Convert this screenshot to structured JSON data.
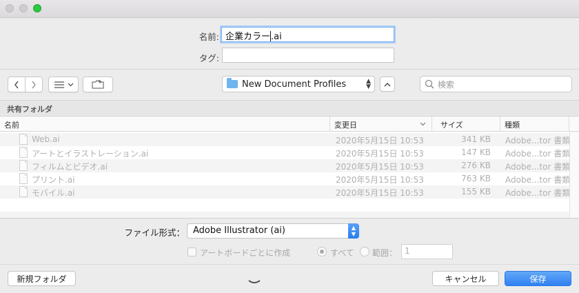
{
  "save": {
    "name_label": "名前:",
    "name_value": "企業カラー",
    "name_suffix": ".ai",
    "tags_label": "タグ:",
    "tags_value": ""
  },
  "toolbar": {
    "location": "New Document Profiles",
    "search_placeholder": "検索"
  },
  "sidebar": {
    "section": "共有フォルダ"
  },
  "table": {
    "columns": {
      "name": "名前",
      "modified": "変更日",
      "size": "サイズ",
      "kind": "種類"
    },
    "rows": [
      {
        "name": "Web.ai",
        "modified": "2020年5月15日 10:53",
        "size": "341 KB",
        "kind": "Adobe...tor 書類"
      },
      {
        "name": "アートとイラストレーション.ai",
        "modified": "2020年5月15日 10:53",
        "size": "147 KB",
        "kind": "Adobe...tor 書類"
      },
      {
        "name": "フィルムとビデオ.ai",
        "modified": "2020年5月15日 10:53",
        "size": "276 KB",
        "kind": "Adobe...tor 書類"
      },
      {
        "name": "プリント.ai",
        "modified": "2020年5月15日 10:53",
        "size": "763 KB",
        "kind": "Adobe...tor 書類"
      },
      {
        "name": "モバイル.ai",
        "modified": "2020年5月15日 10:53",
        "size": "155 KB",
        "kind": "Adobe...tor 書類"
      }
    ]
  },
  "options": {
    "format_label": "ファイル形式：",
    "format_value": "Adobe Illustrator (ai)",
    "artboards_label": "アートボードごとに作成",
    "all_label": "すべて",
    "range_label": "範囲：",
    "range_value": "1"
  },
  "footer": {
    "new_folder": "新規フォルダ",
    "cancel": "キャンセル",
    "save": "保存"
  },
  "colors": {
    "accent": "#2f80f1",
    "zoom": "#2bc840",
    "folder": "#6fb5ee"
  }
}
